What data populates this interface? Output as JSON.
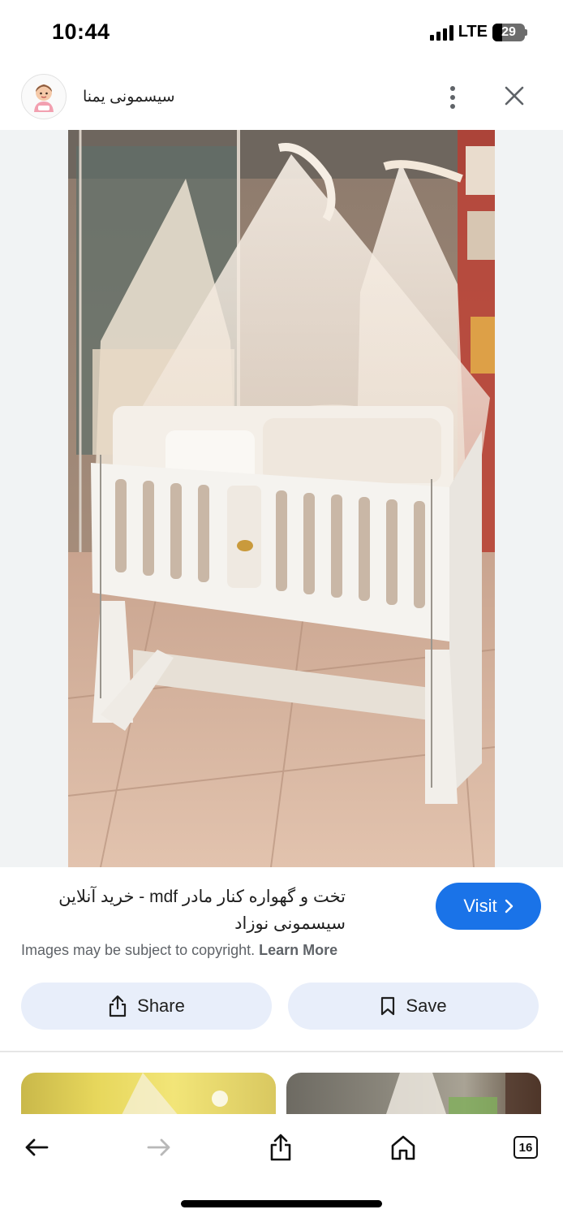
{
  "status_bar": {
    "time": "10:44",
    "network": "LTE",
    "battery_percent": 29
  },
  "header": {
    "site_name": "سیسمونی یمنا",
    "avatar_icon": "baby-avatar-icon",
    "more_icon": "more-vert-icon",
    "close_icon": "close-icon"
  },
  "image": {
    "subject": "crib-photo"
  },
  "info": {
    "title_line1": "تخت و گهواره کنار مادر mdf - خرید آنلاین",
    "title_line2": "سیسمونی نوزاد",
    "visit_label": "Visit",
    "copyright_text": "Images may be subject to copyright.",
    "learn_more_label": "Learn More"
  },
  "actions": {
    "share_label": "Share",
    "save_label": "Save"
  },
  "toolbar": {
    "tabs_count": "16"
  },
  "colors": {
    "accent": "#1a73e8",
    "chip_bg": "#e8eefa",
    "image_bg": "#f1f3f4"
  }
}
